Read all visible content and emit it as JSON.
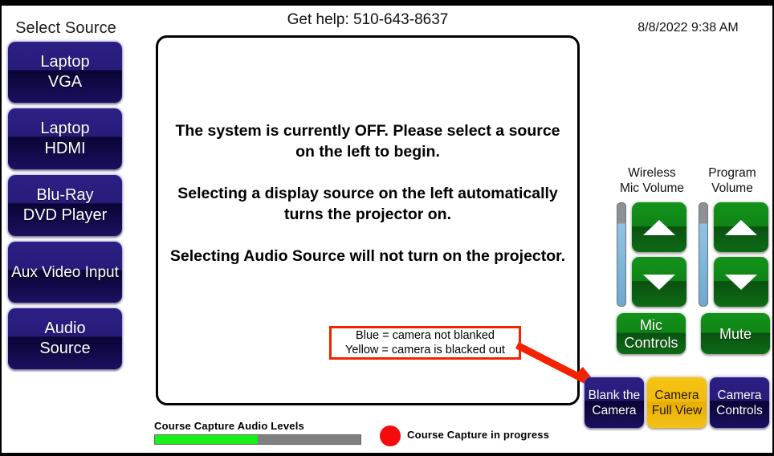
{
  "header": {
    "help_text": "Get help: 510-643-8637",
    "datetime": "8/8/2022 9:38 AM"
  },
  "sidebar": {
    "title": "Select Source",
    "items": [
      {
        "line1": "Laptop",
        "line2": "VGA"
      },
      {
        "line1": "Laptop",
        "line2": "HDMI"
      },
      {
        "line1": "Blu-Ray",
        "line2": "DVD Player"
      },
      {
        "line1": "Aux Video Input",
        "line2": ""
      },
      {
        "line1": "Audio",
        "line2": "Source"
      }
    ]
  },
  "main": {
    "paragraphs": [
      "The system is currently OFF. Please select a source on the left to begin.",
      "Selecting a display source on the left automatically turns the projector on.",
      "Selecting Audio Source will not turn on the projector."
    ]
  },
  "callout": {
    "line1": "Blue = camera not blanked",
    "line2": "Yellow = camera is blacked out",
    "border_color": "#f52200",
    "arrow_color": "#f52200"
  },
  "volume": {
    "mic": {
      "label_line1": "Wireless",
      "label_line2": "Mic Volume",
      "level_percent": 80,
      "up_icon": "triangle-up-icon",
      "down_icon": "triangle-down-icon",
      "action_line1": "Mic",
      "action_line2": "Controls"
    },
    "program": {
      "label_line1": "Program",
      "label_line2": "Volume",
      "level_percent": 80,
      "up_icon": "triangle-up-icon",
      "down_icon": "triangle-down-icon",
      "action_line1": "Mute",
      "action_line2": ""
    }
  },
  "camera": {
    "buttons": [
      {
        "line1": "Blank the",
        "line2": "Camera",
        "state": "blue"
      },
      {
        "line1": "Camera",
        "line2": "Full View",
        "state": "yellow"
      },
      {
        "line1": "Camera",
        "line2": "Controls",
        "state": "blue"
      }
    ]
  },
  "capture": {
    "levels_label": "Course Capture Audio Levels",
    "level_percent": 50,
    "status_text": "Course Capture in progress",
    "indicator_icon": "record-dot-icon",
    "fill_color": "#18f018",
    "track_color": "#808080",
    "dot_color": "#f60b0b"
  }
}
